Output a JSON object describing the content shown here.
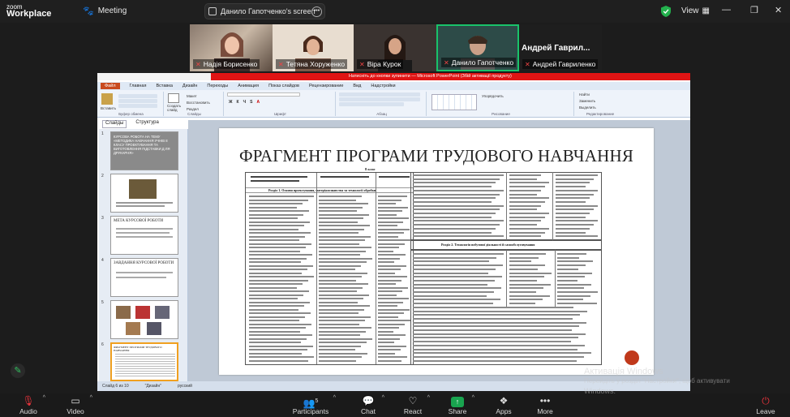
{
  "app": {
    "logo_top": "zoom",
    "logo_bottom": "Workplace",
    "meeting_label": "Meeting",
    "share_pill_label": "Данило Гапотченко's screen",
    "view_label": "View"
  },
  "participants": [
    {
      "name": "Надія Борисенко"
    },
    {
      "name": "Тетяна Хоруженко"
    },
    {
      "name": "Віра Курок"
    },
    {
      "name": "Данило Гапотченко"
    },
    {
      "name": "Андрей Гаврил...",
      "full": "Андрей Гавриленко"
    }
  ],
  "powerpoint": {
    "titlebar": "Натисніть до кнопки зупинити — Microsoft PowerPoint (Збій активації продукту)",
    "menu": [
      "Файл",
      "Главная",
      "Вставка",
      "Дизайн",
      "Переходы",
      "Анимация",
      "Показ слайдов",
      "Рецензирование",
      "Вид",
      "Надстройки"
    ],
    "ribbon_groups": [
      "Буфер обмена",
      "Слайды",
      "Шрифт",
      "Абзац",
      "Рисование",
      "Редактирование"
    ],
    "ribbon_buttons": {
      "paste": "Вставить",
      "new_slide": "Создать слайд",
      "layout": "Макет",
      "reset": "Восстановить",
      "section": "Раздел",
      "arrange": "Упорядочить",
      "find": "Найти",
      "replace": "Заменить",
      "select": "Выделить"
    },
    "panel_tabs": [
      "Слайды",
      "Структура"
    ],
    "slide_title": "ФРАГМЕНТ ПРОГРАМИ ТРУДОВОГО НАВЧАННЯ",
    "doc_heading": "8 клас",
    "section1": "Розділ 1. Основи проектування, матеріалознавства та технології обробки",
    "section2": "Розділ 2. Технологія побутової діяльності й самообслуговування",
    "status": {
      "slide": "Слайд 6 из 10",
      "theme": "\"Дизайн\"",
      "lang": "русский"
    },
    "thumbs": [
      {
        "num": "1",
        "caption": "КУРСОВА РОБОТА НА ТЕМУ «МЕТОДИКА НАВЧАННЯ УЧНІВ 8 КЛАСУ ПРОЕКТУВАННЯ ТА ВИГОТОВЛЕННЯ ПІДСТАВКИ Д ЛЯ ДРУКАРНЯ»"
      },
      {
        "num": "2",
        "caption": ""
      },
      {
        "num": "3",
        "caption": "МЕТА КУРСОВОЇ РОБОТИ"
      },
      {
        "num": "4",
        "caption": "ЗАВДАННЯ КУРСОВОЇ РОБОТИ"
      },
      {
        "num": "5",
        "caption": ""
      },
      {
        "num": "6",
        "caption": "ФРАГМЕНТ ПРОГРАМИ ТРУДОВОГО НАВЧАННЯ"
      }
    ]
  },
  "watermark": {
    "line1": "Активація Windows",
    "line2": "Перейдіть у розділ \"Настройки\", щоб активувати",
    "line3": "Windows."
  },
  "toolbar": [
    {
      "label": "Audio",
      "icon": "mic-muted-icon"
    },
    {
      "label": "Video",
      "icon": "video-icon"
    },
    {
      "label": "Participants",
      "icon": "participants-icon",
      "count": "5"
    },
    {
      "label": "Chat",
      "icon": "chat-icon"
    },
    {
      "label": "React",
      "icon": "heart-icon"
    },
    {
      "label": "Share",
      "icon": "share-icon"
    },
    {
      "label": "Apps",
      "icon": "apps-icon"
    },
    {
      "label": "More",
      "icon": "more-icon"
    },
    {
      "label": "Leave",
      "icon": "leave-icon"
    }
  ],
  "colors": {
    "accent_green": "#19a44f",
    "leave_red": "#e0323a",
    "ppt_red": "#e01414"
  }
}
